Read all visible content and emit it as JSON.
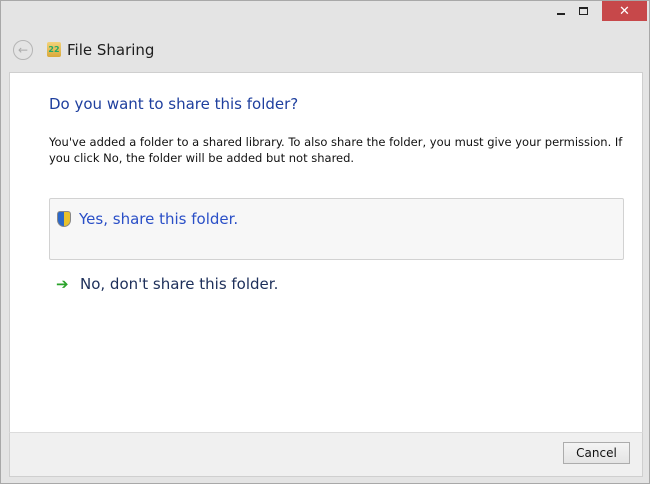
{
  "window": {
    "title": "File Sharing",
    "minimize": "–",
    "close": "✕"
  },
  "dialog": {
    "heading": "Do you want to share this folder?",
    "description": "You've added a folder to a shared library. To also share the folder, you must give your permission. If you click No, the folder will be added but not shared.",
    "yes_option": "Yes, share this folder.",
    "no_option": "No, don't share this folder."
  },
  "footer": {
    "cancel": "Cancel"
  }
}
